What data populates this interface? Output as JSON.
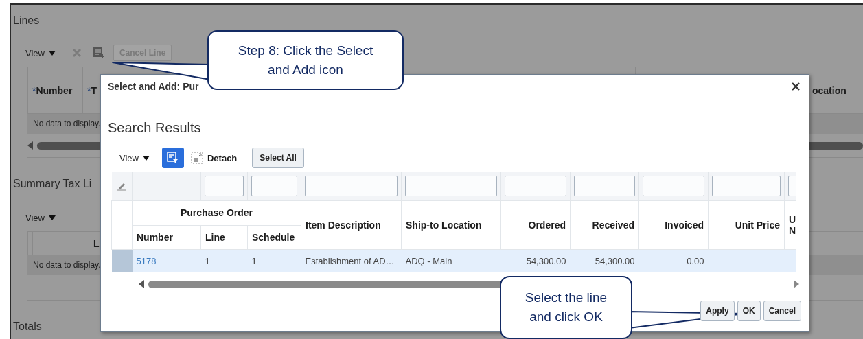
{
  "background_page": {
    "lines": {
      "title": "Lines",
      "view": "View",
      "cancel_button": {
        "label": "Cancel Line",
        "disabled": true
      },
      "columns": [
        {
          "marker": "*",
          "label": "Number"
        },
        {
          "marker": "*",
          "label": "T"
        },
        {
          "label": "ocation"
        }
      ],
      "empty_text": "No data to display."
    },
    "summary_tax_lines": {
      "title": "Summary Tax Li",
      "view": "View",
      "column": "Li",
      "empty_text": "No data to display."
    },
    "totals": {
      "title": "Totals"
    }
  },
  "dialog": {
    "title": "Select and Add: Pur",
    "heading": "Search Results",
    "toolbar": {
      "view": "View",
      "filter_toggle": {
        "on": true
      },
      "detach": "Detach",
      "select_all": "Select All"
    },
    "table": {
      "group_header": "Purchase Order",
      "columns": [
        {
          "label": "Number",
          "kind": "text",
          "grouped": true,
          "filter": false
        },
        {
          "label": "Line",
          "kind": "text",
          "grouped": true,
          "filter": true
        },
        {
          "label": "Schedule",
          "kind": "text",
          "grouped": true,
          "filter": true
        },
        {
          "label": "Item Description",
          "kind": "text",
          "grouped": false,
          "filter": true
        },
        {
          "label": "Ship-to Location",
          "kind": "text",
          "grouped": false,
          "filter": true
        },
        {
          "label": "Ordered",
          "kind": "amount",
          "grouped": false,
          "filter": true
        },
        {
          "label": "Received",
          "kind": "amount",
          "grouped": false,
          "filter": true
        },
        {
          "label": "Invoiced",
          "kind": "amount",
          "grouped": false,
          "filter": true
        },
        {
          "label": "Unit Price",
          "kind": "amount",
          "grouped": false,
          "filter": true
        },
        {
          "label": "U\nN",
          "kind": "text",
          "grouped": false,
          "filter": true
        }
      ],
      "rows": [
        {
          "selected": true,
          "cells": [
            {
              "text": "5178",
              "kind": "link"
            },
            {
              "text": "1",
              "kind": "text"
            },
            {
              "text": "1",
              "kind": "text"
            },
            {
              "text": "Establishment of AD…",
              "kind": "text"
            },
            {
              "text": "ADQ - Main",
              "kind": "text"
            },
            {
              "text": "54,300.00",
              "kind": "text"
            },
            {
              "text": "54,300.00",
              "kind": "text"
            },
            {
              "text": "0.00",
              "kind": "text"
            }
          ]
        }
      ]
    },
    "buttons": [
      "Apply",
      "OK",
      "Cancel"
    ]
  },
  "callouts": [
    {
      "text": "Step 8: Click the Select and Add icon"
    },
    {
      "text": "Select the line and click OK"
    }
  ]
}
